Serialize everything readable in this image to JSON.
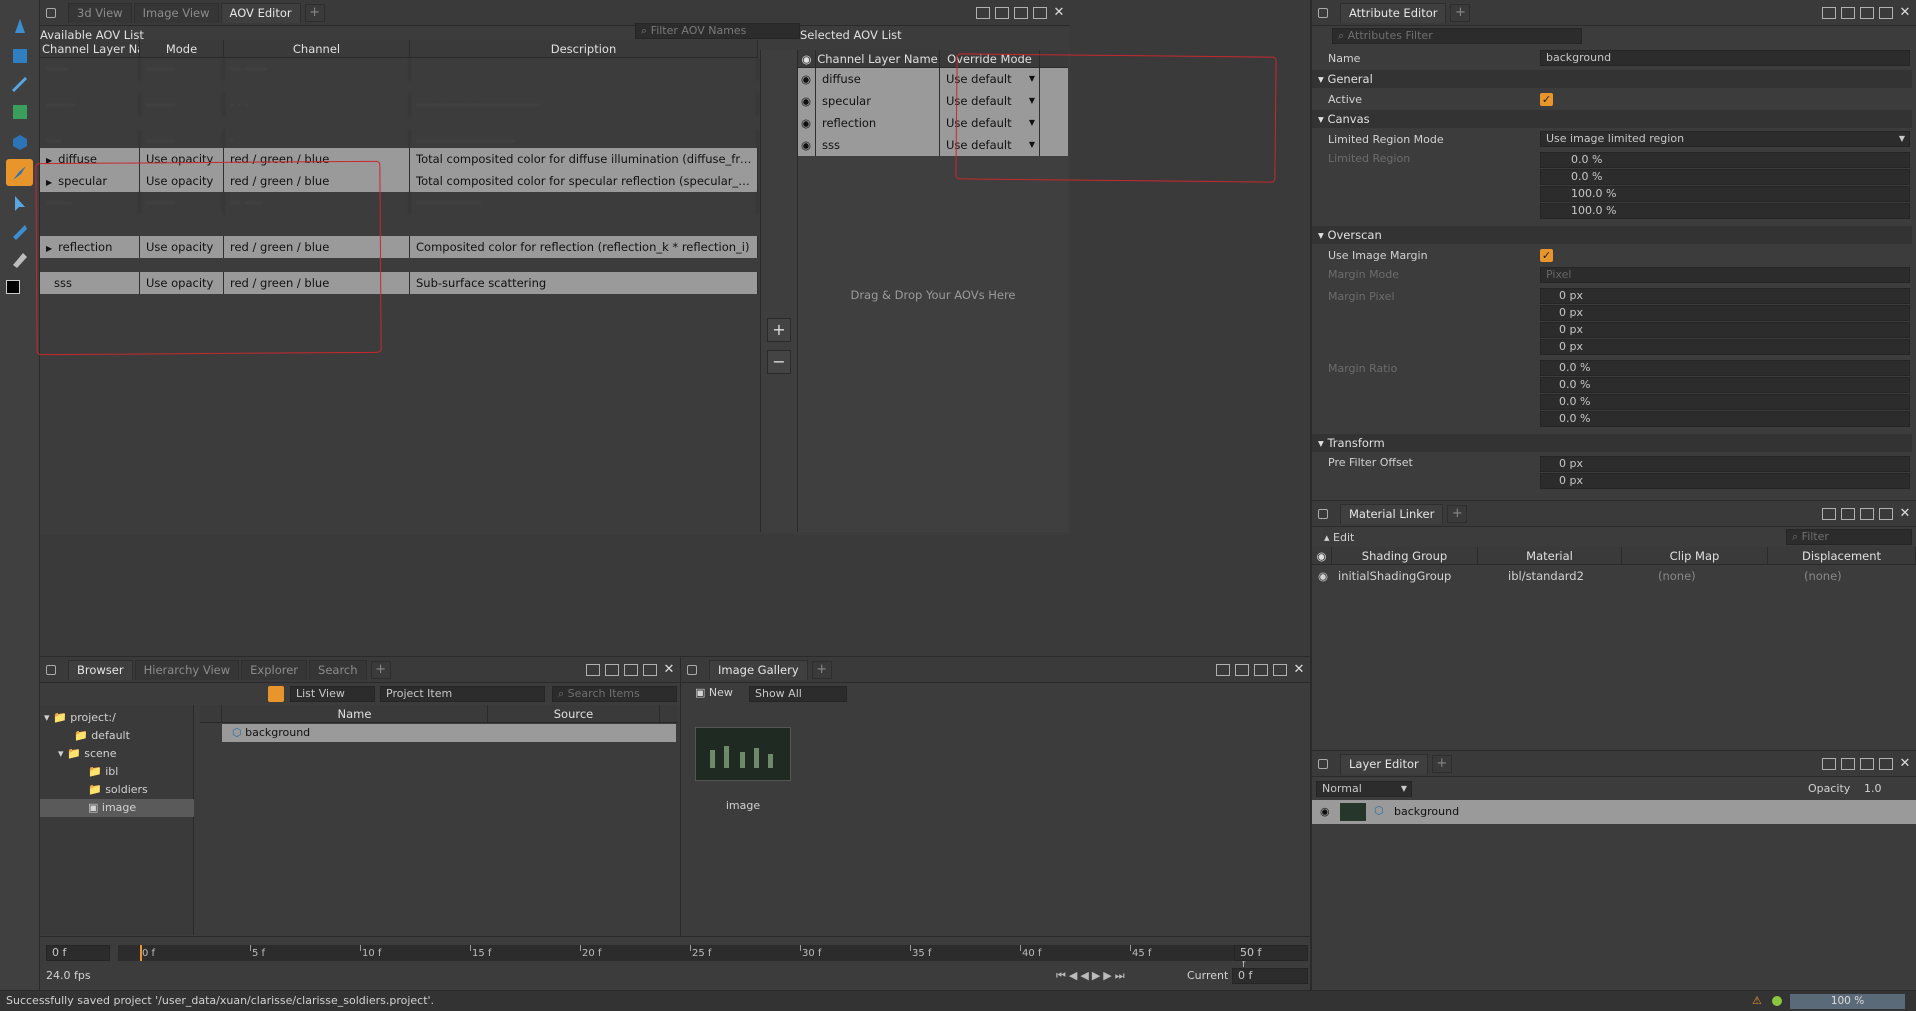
{
  "aov_editor": {
    "tabs": [
      "3d View",
      "Image View",
      "AOV Editor"
    ],
    "available_title": "Available AOV List",
    "filter_placeholder": "Filter AOV Names",
    "columns": [
      "Channel Layer Name",
      "Mode",
      "Channel",
      "Description"
    ],
    "rows": [
      {
        "name": "diffuse",
        "mode": "Use opacity",
        "channel": "red / green / blue",
        "desc": "Total composited color for diffuse illumination (diffuse_front + diffuse_..."
      },
      {
        "name": "specular",
        "mode": "Use opacity",
        "channel": "red / green / blue",
        "desc": "Total composited color for specular reflection (specular_direct + specul..."
      },
      {
        "name": "reflection",
        "mode": "Use opacity",
        "channel": "red / green / blue",
        "desc": "Composited color for reflection (reflection_k * reflection_i)"
      },
      {
        "name": "sss",
        "mode": "Use opacity",
        "channel": "red / green / blue",
        "desc": "Sub-surface scattering"
      }
    ],
    "selected_title": "Selected AOV List",
    "selected_columns": [
      "Channel Layer Name",
      "Override Mode"
    ],
    "selected_rows": [
      {
        "name": "diffuse",
        "mode": "Use default"
      },
      {
        "name": "specular",
        "mode": "Use default"
      },
      {
        "name": "reflection",
        "mode": "Use default"
      },
      {
        "name": "sss",
        "mode": "Use default"
      }
    ],
    "drop_hint": "Drag & Drop Your AOVs Here"
  },
  "attribute_editor": {
    "tab": "Attribute Editor",
    "filter_placeholder": "Attributes Filter",
    "name_label": "Name",
    "name_value": "background",
    "general": "General",
    "active_label": "Active",
    "canvas": "Canvas",
    "limited_region_mode_label": "Limited Region Mode",
    "limited_region_mode_value": "Use image limited region",
    "limited_region_label": "Limited Region",
    "limited_region_values": [
      "0.0 %",
      "0.0 %",
      "100.0 %",
      "100.0 %"
    ],
    "overscan": "Overscan",
    "use_image_margin_label": "Use Image Margin",
    "margin_mode_label": "Margin Mode",
    "margin_mode_value": "Pixel",
    "margin_pixel_label": "Margin Pixel",
    "margin_pixel_values": [
      "0 px",
      "0 px",
      "0 px",
      "0 px"
    ],
    "margin_ratio_label": "Margin Ratio",
    "margin_ratio_values": [
      "0.0 %",
      "0.0 %",
      "0.0 %",
      "0.0 %"
    ],
    "transform": "Transform",
    "pre_filter_label": "Pre Filter Offset",
    "pre_filter_values": [
      "0 px",
      "0 px"
    ]
  },
  "material_linker": {
    "tab": "Material Linker",
    "edit": "Edit",
    "filter_placeholder": "Filter",
    "columns": [
      "Shading Group",
      "Material",
      "Clip Map",
      "Displacement"
    ],
    "row": {
      "group": "initialShadingGroup",
      "material": "ibl/standard2",
      "clip": "(none)",
      "disp": "(none)"
    }
  },
  "layer_editor": {
    "tab": "Layer Editor",
    "blend": "Normal",
    "opacity_label": "Opacity",
    "opacity_value": "1.0",
    "layer": "background"
  },
  "browser": {
    "tabs": [
      "Browser",
      "Hierarchy View",
      "Explorer",
      "Search"
    ],
    "view_mode": "List View",
    "item_type": "Project Item",
    "search_placeholder": "Search Items",
    "tree": [
      "project:/",
      "default",
      "scene",
      "ibl",
      "soldiers",
      "image"
    ],
    "columns": [
      "Name",
      "Source"
    ],
    "item": "background"
  },
  "gallery": {
    "tab": "Image Gallery",
    "new": "New",
    "show": "Show All",
    "thumb_label": "image"
  },
  "timeline": {
    "start": "0 f",
    "end": "50 f",
    "ticks": [
      "0 f",
      "5 f",
      "10 f",
      "15 f",
      "20 f",
      "25 f",
      "30 f",
      "35 f",
      "40 f",
      "45 f",
      "50 f"
    ],
    "fps": "24.0 fps",
    "current_label": "Current",
    "current_value": "0 f"
  },
  "status": {
    "message": "Successfully saved project '/user_data/xuan/clarisse/clarisse_soldiers.project'.",
    "zoom": "100 %"
  },
  "colors": {
    "accent": "#e8962c",
    "annotation": "#c8282d",
    "highlight_row": "#9a9a9a"
  }
}
